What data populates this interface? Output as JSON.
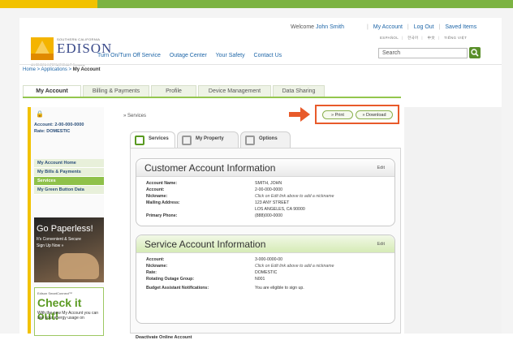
{
  "brand": {
    "small_text": "SOUTHERN CALIFORNIA",
    "name": "EDISON",
    "tagline": "AN EDISON INTERNATIONAL® Company"
  },
  "header": {
    "welcome_prefix": "Welcome",
    "user_name": "John Smith",
    "links": [
      "My Account",
      "Log Out",
      "Saved Items"
    ],
    "languages": [
      "ESPAÑOL",
      "한국어",
      "中文",
      "TIẾNG VIỆT"
    ],
    "search_placeholder": "Search",
    "nav": [
      "Turn On/Turn Off Service",
      "Outage Center",
      "Your Safety",
      "Contact Us"
    ]
  },
  "breadcrumb": {
    "items": [
      "Home",
      "Applications"
    ],
    "current": "My Account"
  },
  "account_tabs": [
    "My Account",
    "Billing & Payments",
    "Profile",
    "Device Management",
    "Data Sharing"
  ],
  "sidebar": {
    "account_label": "Account: 2-00-000-0000",
    "rate_label": "Rate: DOMESTIC",
    "menu": [
      "My Account Home",
      "My Bills & Payments",
      "Services",
      "My Green Button Data"
    ],
    "selected": "Services",
    "promo1": {
      "title": "Go Paperless!",
      "line1": "It's Convenient & Secure",
      "line2": "Sign Up Now »"
    },
    "promo2": {
      "kicker": "Edison SmartConnect™",
      "title": "Check it out!",
      "body": "With the new My Account you can see your energy usage on"
    }
  },
  "content": {
    "services_link": "» Services",
    "print_label": "» Print",
    "download_label": "» Download",
    "tabs": [
      "Services",
      "My Property",
      "Options"
    ],
    "customer_card": {
      "title": "Customer Account Information",
      "edit": "Edit",
      "rows": [
        {
          "k": "Account Name:",
          "v": "SMITH, JOHN",
          "italic": false
        },
        {
          "k": "Account:",
          "v": "2-00-000-0000",
          "italic": false
        },
        {
          "k": "Nickname:",
          "v": "Click on Edit link above to add a nickname",
          "italic": true
        },
        {
          "k": "Mailing Address:",
          "v": "123 ANY STREET",
          "italic": false
        },
        {
          "k": "",
          "v": "LOS ANGELES, CA 90000",
          "italic": false
        },
        {
          "k": "Primary Phone:",
          "v": "(888)000-0000",
          "italic": false
        }
      ]
    },
    "service_card": {
      "title": "Service Account Information",
      "edit": "Edit",
      "rows": [
        {
          "k": "Account:",
          "v": "3-000-0000-00",
          "italic": false
        },
        {
          "k": "Nickname:",
          "v": "Click on Edit link above to add a nickname",
          "italic": true
        },
        {
          "k": "Rate:",
          "v": "DOMESTIC",
          "italic": false
        },
        {
          "k": "Rotating Outage Group:",
          "v": "N001",
          "italic": false
        },
        {
          "k": "Budget Assistant Notifications:",
          "v": "You are eligible to sign up.",
          "italic": false
        }
      ]
    },
    "deactivate": "Deactivate Online Account"
  },
  "colors": {
    "accent_green": "#8fc14a",
    "accent_yellow": "#f2c200",
    "highlight_orange": "#e85a2a",
    "link_blue": "#1e66a8"
  }
}
